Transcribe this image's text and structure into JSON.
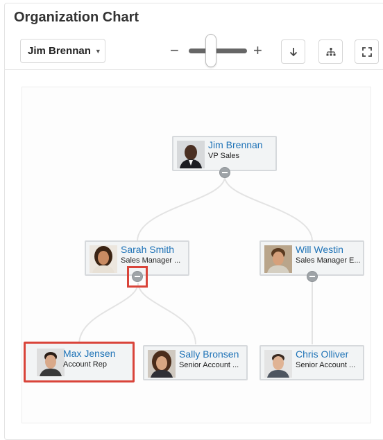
{
  "title": "Organization Chart",
  "selector": {
    "value": "Jim Brennan",
    "caret": "▼"
  },
  "zoom": {
    "minus": "−",
    "plus": "+",
    "level": 0.45
  },
  "icons": {
    "download": "download-icon",
    "hierarchy": "hierarchy-icon",
    "fullscreen": "fullscreen-icon"
  },
  "colors": {
    "name_link": "#1f73b7",
    "highlight": "#d9443a"
  },
  "nodes": [
    {
      "name": "Jim Brennan",
      "role": "VP Sales"
    },
    {
      "name": "Sarah Smith",
      "role": "Sales Manager ..."
    },
    {
      "name": "Will Westin",
      "role": "Sales Manager E..."
    },
    {
      "name": "Max Jensen",
      "role": "Account Rep"
    },
    {
      "name": "Sally Bronsen",
      "role": "Senior Account ..."
    },
    {
      "name": "Chris Olliver",
      "role": "Senior Account ..."
    }
  ]
}
